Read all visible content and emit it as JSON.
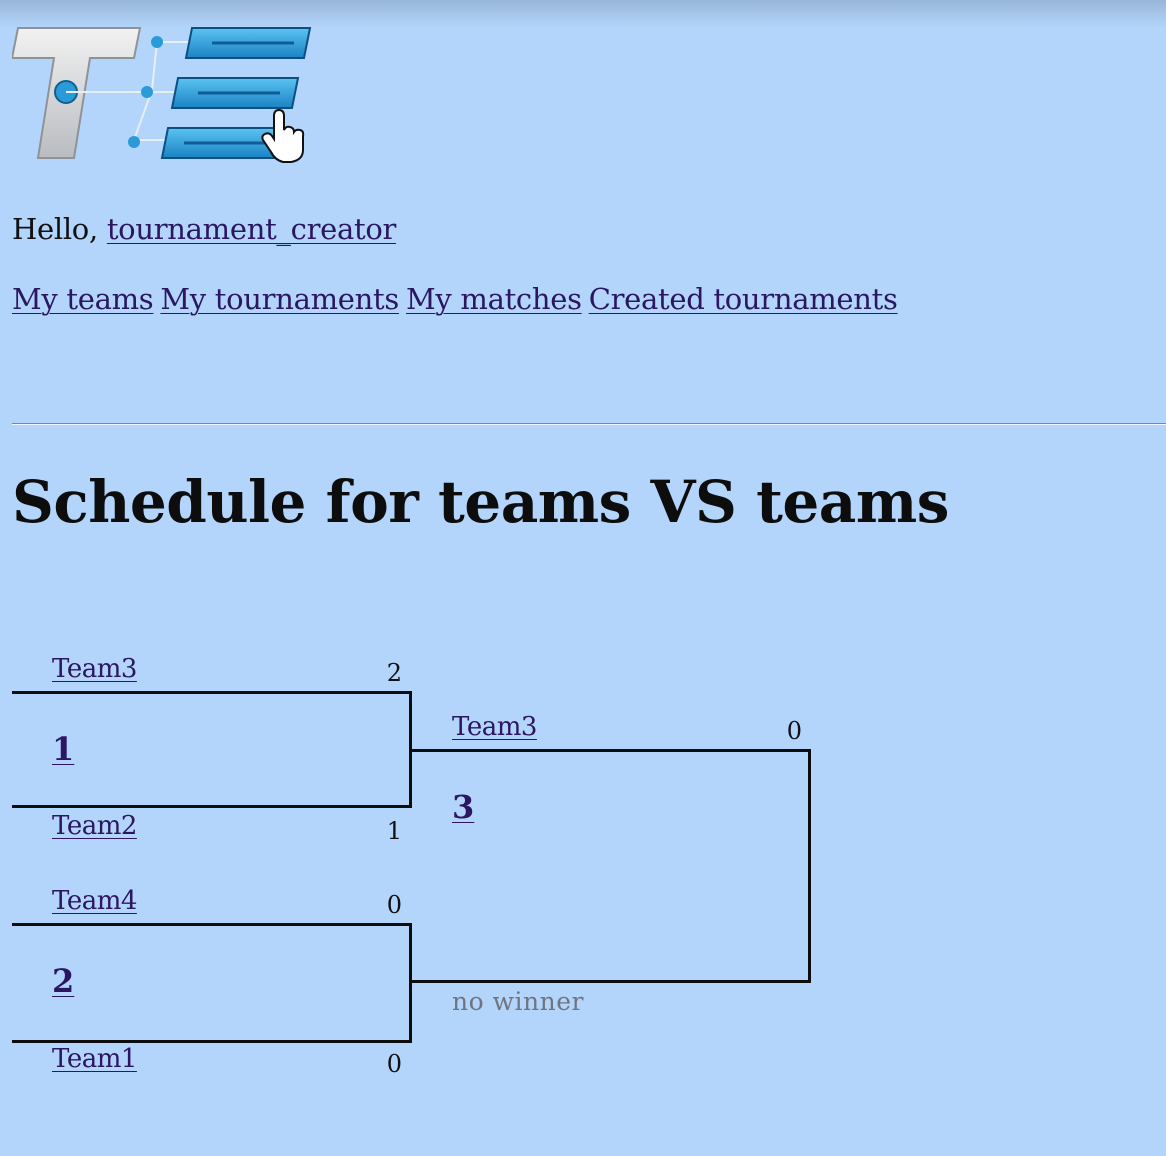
{
  "header": {
    "greeting_prefix": "Hello,",
    "username": "tournament_creator"
  },
  "nav": {
    "items": [
      {
        "label": "My teams"
      },
      {
        "label": "My tournaments"
      },
      {
        "label": "My matches"
      },
      {
        "label": "Created tournaments"
      }
    ]
  },
  "page": {
    "title": "Schedule for teams VS teams"
  },
  "bracket": {
    "matches": [
      {
        "number": "1",
        "top_team": "Team3",
        "top_score": "2",
        "bottom_team": "Team2",
        "bottom_score": "1"
      },
      {
        "number": "2",
        "top_team": "Team4",
        "top_score": "0",
        "bottom_team": "Team1",
        "bottom_score": "0"
      },
      {
        "number": "3",
        "top_team": "Team3",
        "top_score": "0",
        "bottom_label": "no winner"
      }
    ]
  },
  "colors": {
    "background": "#b3d5fb",
    "link": "#2a1661",
    "logo_accent": "#2a9bd8"
  }
}
